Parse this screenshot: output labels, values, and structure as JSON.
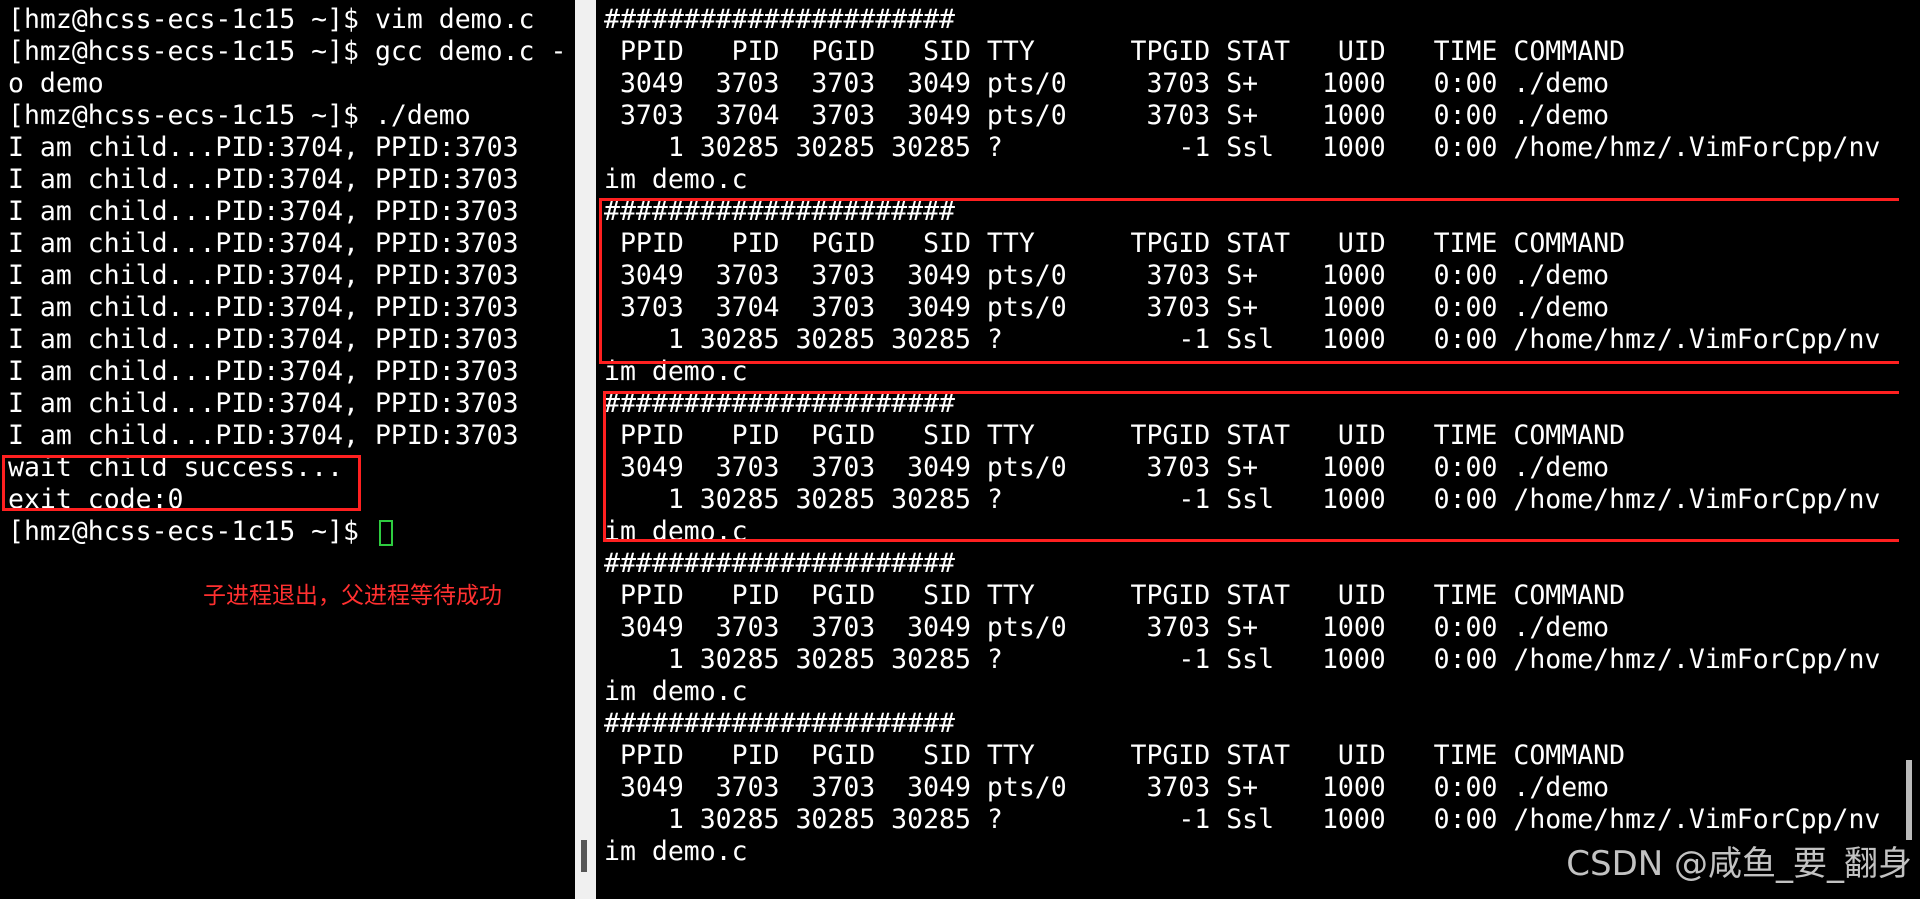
{
  "left_terminal": {
    "lines": [
      "[hmz@hcss-ecs-1c15 ~]$ vim demo.c",
      "[hmz@hcss-ecs-1c15 ~]$ gcc demo.c -",
      "o demo",
      "[hmz@hcss-ecs-1c15 ~]$ ./demo",
      "I am child...PID:3704, PPID:3703",
      "I am child...PID:3704, PPID:3703",
      "I am child...PID:3704, PPID:3703",
      "I am child...PID:3704, PPID:3703",
      "I am child...PID:3704, PPID:3703",
      "I am child...PID:3704, PPID:3703",
      "I am child...PID:3704, PPID:3703",
      "I am child...PID:3704, PPID:3703",
      "I am child...PID:3704, PPID:3703",
      "I am child...PID:3704, PPID:3703",
      "wait child success...",
      "exit code:0",
      "[hmz@hcss-ecs-1c15 ~]$ "
    ],
    "annotation": "子进程退出，父进程等待成功"
  },
  "right_terminal": {
    "lines": [
      "######################",
      " PPID   PID  PGID   SID TTY      TPGID STAT   UID   TIME COMMAND",
      " 3049  3703  3703  3049 pts/0     3703 S+    1000   0:00 ./demo",
      " 3703  3704  3703  3049 pts/0     3703 S+    1000   0:00 ./demo",
      "    1 30285 30285 30285 ?           -1 Ssl   1000   0:00 /home/hmz/.VimForCpp/nv",
      "im demo.c",
      "######################",
      " PPID   PID  PGID   SID TTY      TPGID STAT   UID   TIME COMMAND",
      " 3049  3703  3703  3049 pts/0     3703 S+    1000   0:00 ./demo",
      " 3703  3704  3703  3049 pts/0     3703 S+    1000   0:00 ./demo",
      "    1 30285 30285 30285 ?           -1 Ssl   1000   0:00 /home/hmz/.VimForCpp/nv",
      "im demo.c",
      "######################",
      " PPID   PID  PGID   SID TTY      TPGID STAT   UID   TIME COMMAND",
      " 3049  3703  3703  3049 pts/0     3703 S+    1000   0:00 ./demo",
      "    1 30285 30285 30285 ?           -1 Ssl   1000   0:00 /home/hmz/.VimForCpp/nv",
      "im demo.c",
      "######################",
      " PPID   PID  PGID   SID TTY      TPGID STAT   UID   TIME COMMAND",
      " 3049  3703  3703  3049 pts/0     3703 S+    1000   0:00 ./demo",
      "    1 30285 30285 30285 ?           -1 Ssl   1000   0:00 /home/hmz/.VimForCpp/nv",
      "im demo.c",
      "######################",
      " PPID   PID  PGID   SID TTY      TPGID STAT   UID   TIME COMMAND",
      " 3049  3703  3703  3049 pts/0     3703 S+    1000   0:00 ./demo",
      "    1 30285 30285 30285 ?           -1 Ssl   1000   0:00 /home/hmz/.VimForCpp/nv",
      "im demo.c"
    ]
  },
  "watermark": "CSDN @咸鱼_要_翻身",
  "colors": {
    "terminal_bg": "#000000",
    "terminal_fg": "#ffffff",
    "highlight_box": "#ff2020",
    "cursor": "#2ecc40"
  }
}
